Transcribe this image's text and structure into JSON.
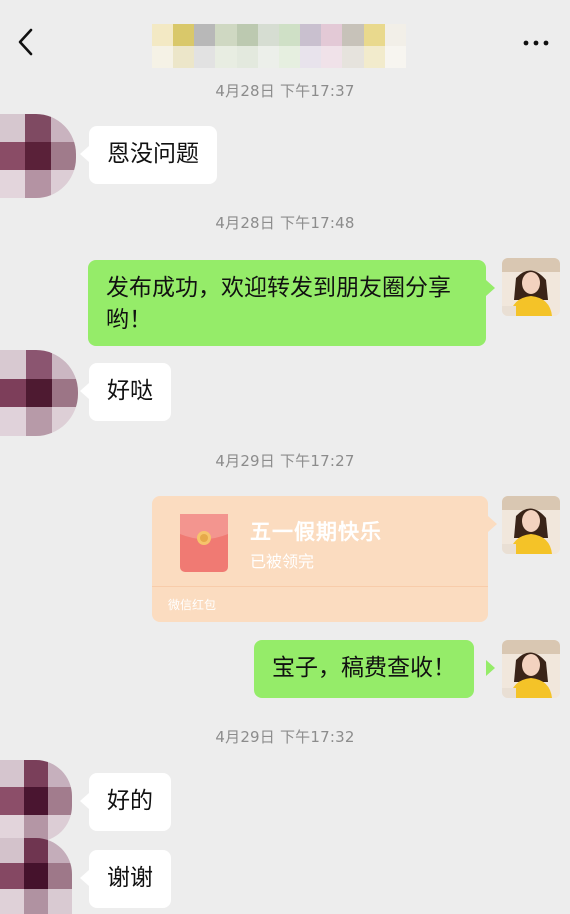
{
  "header": {
    "back_icon": "chevron-left-icon",
    "more_icon": "more-dots-icon",
    "title": ""
  },
  "colors": {
    "background": "#ededed",
    "bubble_sent": "#95ec69",
    "bubble_received": "#ffffff",
    "red_packet": "#fbdcc0",
    "timestamp": "#8c8c8c"
  },
  "timestamps": [
    "4月28日 下午17:37",
    "4月28日 下午17:48",
    "4月29日 下午17:27",
    "4月29日 下午17:32"
  ],
  "messages": [
    {
      "from": "other",
      "text": "恩没问题"
    },
    {
      "from": "me",
      "text": "发布成功，欢迎转发到朋友圈分享哟！"
    },
    {
      "from": "other",
      "text": "好哒"
    },
    {
      "from": "me",
      "type": "red_packet",
      "title": "五一假期快乐",
      "status": "已被领完",
      "brand": "微信红包"
    },
    {
      "from": "me",
      "text": "宝子，稿费查收！"
    },
    {
      "from": "other",
      "text": "好的"
    },
    {
      "from": "other",
      "text": "谢谢"
    }
  ]
}
